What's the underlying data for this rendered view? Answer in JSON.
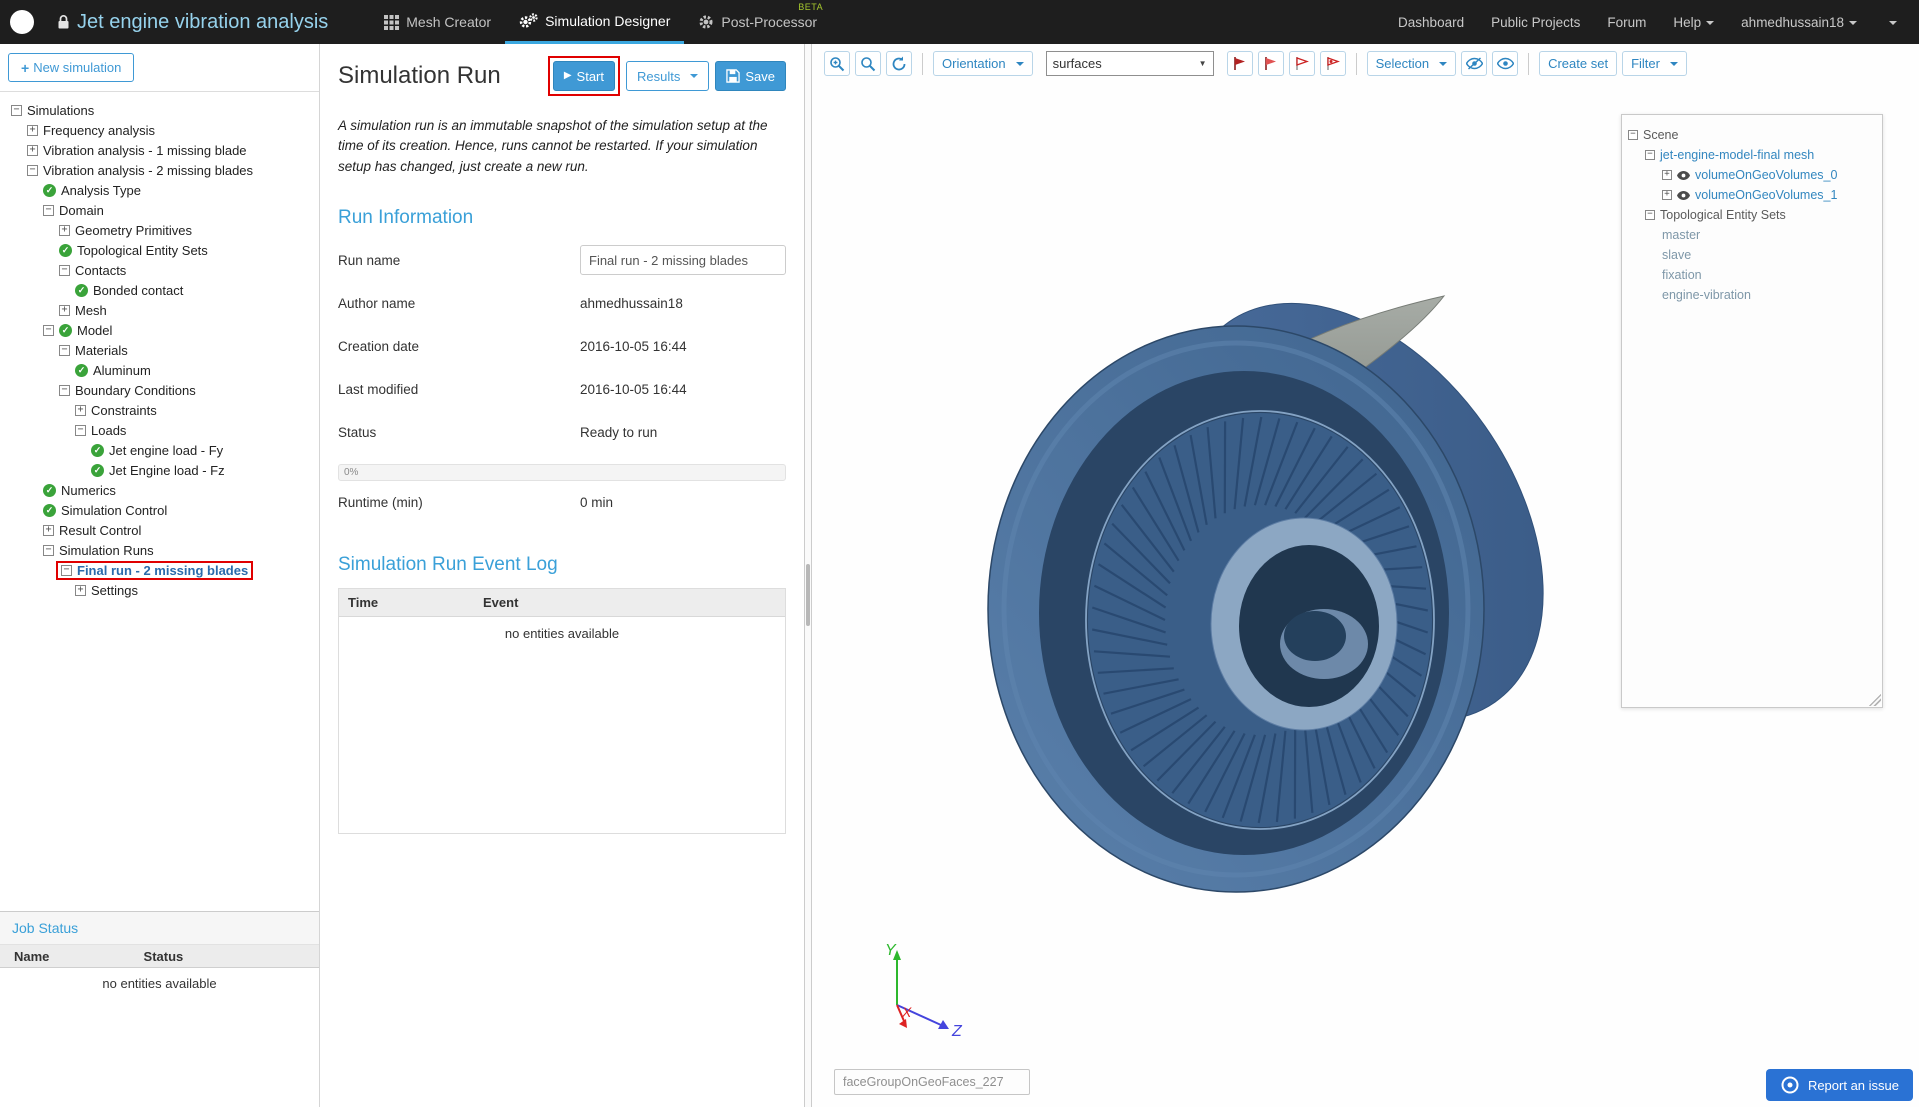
{
  "colors": {
    "navbar-bg": "#1e1e1e",
    "brand-blue": "#3f99d5",
    "title-blue": "#96d2ec",
    "tab-underline": "#3ba8e0",
    "beta-green": "#a6c82e",
    "check-green": "#3aa33a",
    "heading-blue": "#3aa0d8",
    "annotation-red": "#e00000",
    "selected-blue": "#2a6bab"
  },
  "navbar": {
    "project_title": "Jet engine vibration analysis",
    "tabs": [
      {
        "label": "Mesh Creator"
      },
      {
        "label": "Simulation Designer",
        "active": true
      },
      {
        "label": "Post-Processor",
        "badge": "BETA"
      }
    ],
    "links": {
      "dashboard": "Dashboard",
      "public_projects": "Public Projects",
      "forum": "Forum",
      "help": "Help",
      "username": "ahmedhussain18"
    }
  },
  "sidebar": {
    "new_simulation": "New simulation",
    "tree": [
      {
        "indent": 0,
        "icon": "minus",
        "label": "Simulations"
      },
      {
        "indent": 1,
        "icon": "plus",
        "label": "Frequency analysis"
      },
      {
        "indent": 1,
        "icon": "plus",
        "label": "Vibration analysis - 1 missing blade"
      },
      {
        "indent": 1,
        "icon": "minus",
        "label": "Vibration analysis - 2 missing blades"
      },
      {
        "indent": 2,
        "icon": "check",
        "label": "Analysis Type"
      },
      {
        "indent": 2,
        "icon": "minus",
        "label": "Domain"
      },
      {
        "indent": 3,
        "icon": "plus",
        "label": "Geometry Primitives"
      },
      {
        "indent": 3,
        "icon": "check",
        "label": "Topological Entity Sets"
      },
      {
        "indent": 3,
        "icon": "minus",
        "label": "Contacts"
      },
      {
        "indent": 4,
        "icon": "check",
        "label": "Bonded contact"
      },
      {
        "indent": 3,
        "icon": "plus",
        "label": "Mesh"
      },
      {
        "indent": 2,
        "icon": "minus-check",
        "label": "Model"
      },
      {
        "indent": 3,
        "icon": "minus",
        "label": "Materials"
      },
      {
        "indent": 4,
        "icon": "check",
        "label": "Aluminum"
      },
      {
        "indent": 3,
        "icon": "minus",
        "label": "Boundary Conditions"
      },
      {
        "indent": 4,
        "icon": "plus",
        "label": "Constraints"
      },
      {
        "indent": 4,
        "icon": "minus",
        "label": "Loads"
      },
      {
        "indent": 5,
        "icon": "check",
        "label": "Jet engine load - Fy"
      },
      {
        "indent": 5,
        "icon": "check",
        "label": "Jet Engine load - Fz"
      },
      {
        "indent": 2,
        "icon": "check",
        "label": "Numerics"
      },
      {
        "indent": 2,
        "icon": "check",
        "label": "Simulation Control"
      },
      {
        "indent": 2,
        "icon": "plus",
        "label": "Result Control"
      },
      {
        "indent": 2,
        "icon": "minus",
        "label": "Simulation Runs"
      },
      {
        "indent": 3,
        "icon": "minus",
        "label": "Final run - 2 missing blades",
        "selected": true
      },
      {
        "indent": 4,
        "icon": "plus",
        "label": "Settings"
      }
    ],
    "job_status": {
      "title": "Job Status",
      "col_name": "Name",
      "col_status": "Status",
      "empty": "no entities available"
    }
  },
  "panel": {
    "title": "Simulation Run",
    "buttons": {
      "start": "Start",
      "results": "Results",
      "save": "Save"
    },
    "description": "A simulation run is an immutable snapshot of the simulation setup at the time of its creation. Hence, runs cannot be restarted. If your simulation setup has changed, just create a new run.",
    "run_info": {
      "heading": "Run Information",
      "labels": {
        "run_name": "Run name",
        "author": "Author name",
        "creation": "Creation date",
        "modified": "Last modified",
        "status": "Status",
        "runtime": "Runtime (min)"
      },
      "values": {
        "run_name": "Final run - 2 missing blades",
        "author": "ahmedhussain18",
        "creation": "2016-10-05 16:44",
        "modified": "2016-10-05 16:44",
        "status": "Ready to run",
        "progress": "0%",
        "runtime": "0 min"
      }
    },
    "event_log": {
      "heading": "Simulation Run Event Log",
      "col_time": "Time",
      "col_event": "Event",
      "empty": "no entities available"
    }
  },
  "viewport": {
    "toolbar": {
      "orientation": "Orientation",
      "render_mode": "surfaces",
      "selection": "Selection",
      "create_set": "Create set",
      "filter": "Filter"
    },
    "scene_tree": [
      {
        "indent": 0,
        "icon": "minus",
        "label": "Scene",
        "style": "gray"
      },
      {
        "indent": 1,
        "icon": "minus",
        "label": "jet-engine-model-final mesh",
        "style": "blue"
      },
      {
        "indent": 2,
        "icon": "plus-eye",
        "label": "volumeOnGeoVolumes_0",
        "style": "blue"
      },
      {
        "indent": 2,
        "icon": "plus-eye",
        "label": "volumeOnGeoVolumes_1",
        "style": "blue"
      },
      {
        "indent": 1,
        "icon": "minus",
        "label": "Topological Entity Sets",
        "style": "gray"
      },
      {
        "indent": 2,
        "icon": "none",
        "label": "master",
        "style": "muted"
      },
      {
        "indent": 2,
        "icon": "none",
        "label": "slave",
        "style": "muted"
      },
      {
        "indent": 2,
        "icon": "none",
        "label": "fixation",
        "style": "muted"
      },
      {
        "indent": 2,
        "icon": "none",
        "label": "engine-vibration",
        "style": "muted"
      }
    ],
    "model_colors": {
      "body": "#4a6f9e",
      "highlight": "#8ca7c3",
      "blade_gray": "#9aa09a"
    },
    "axes": {
      "x": "X",
      "y": "Y",
      "z": "Z"
    },
    "face_label": "faceGroupOnGeoFaces_227",
    "report_issue": "Report an issue"
  }
}
